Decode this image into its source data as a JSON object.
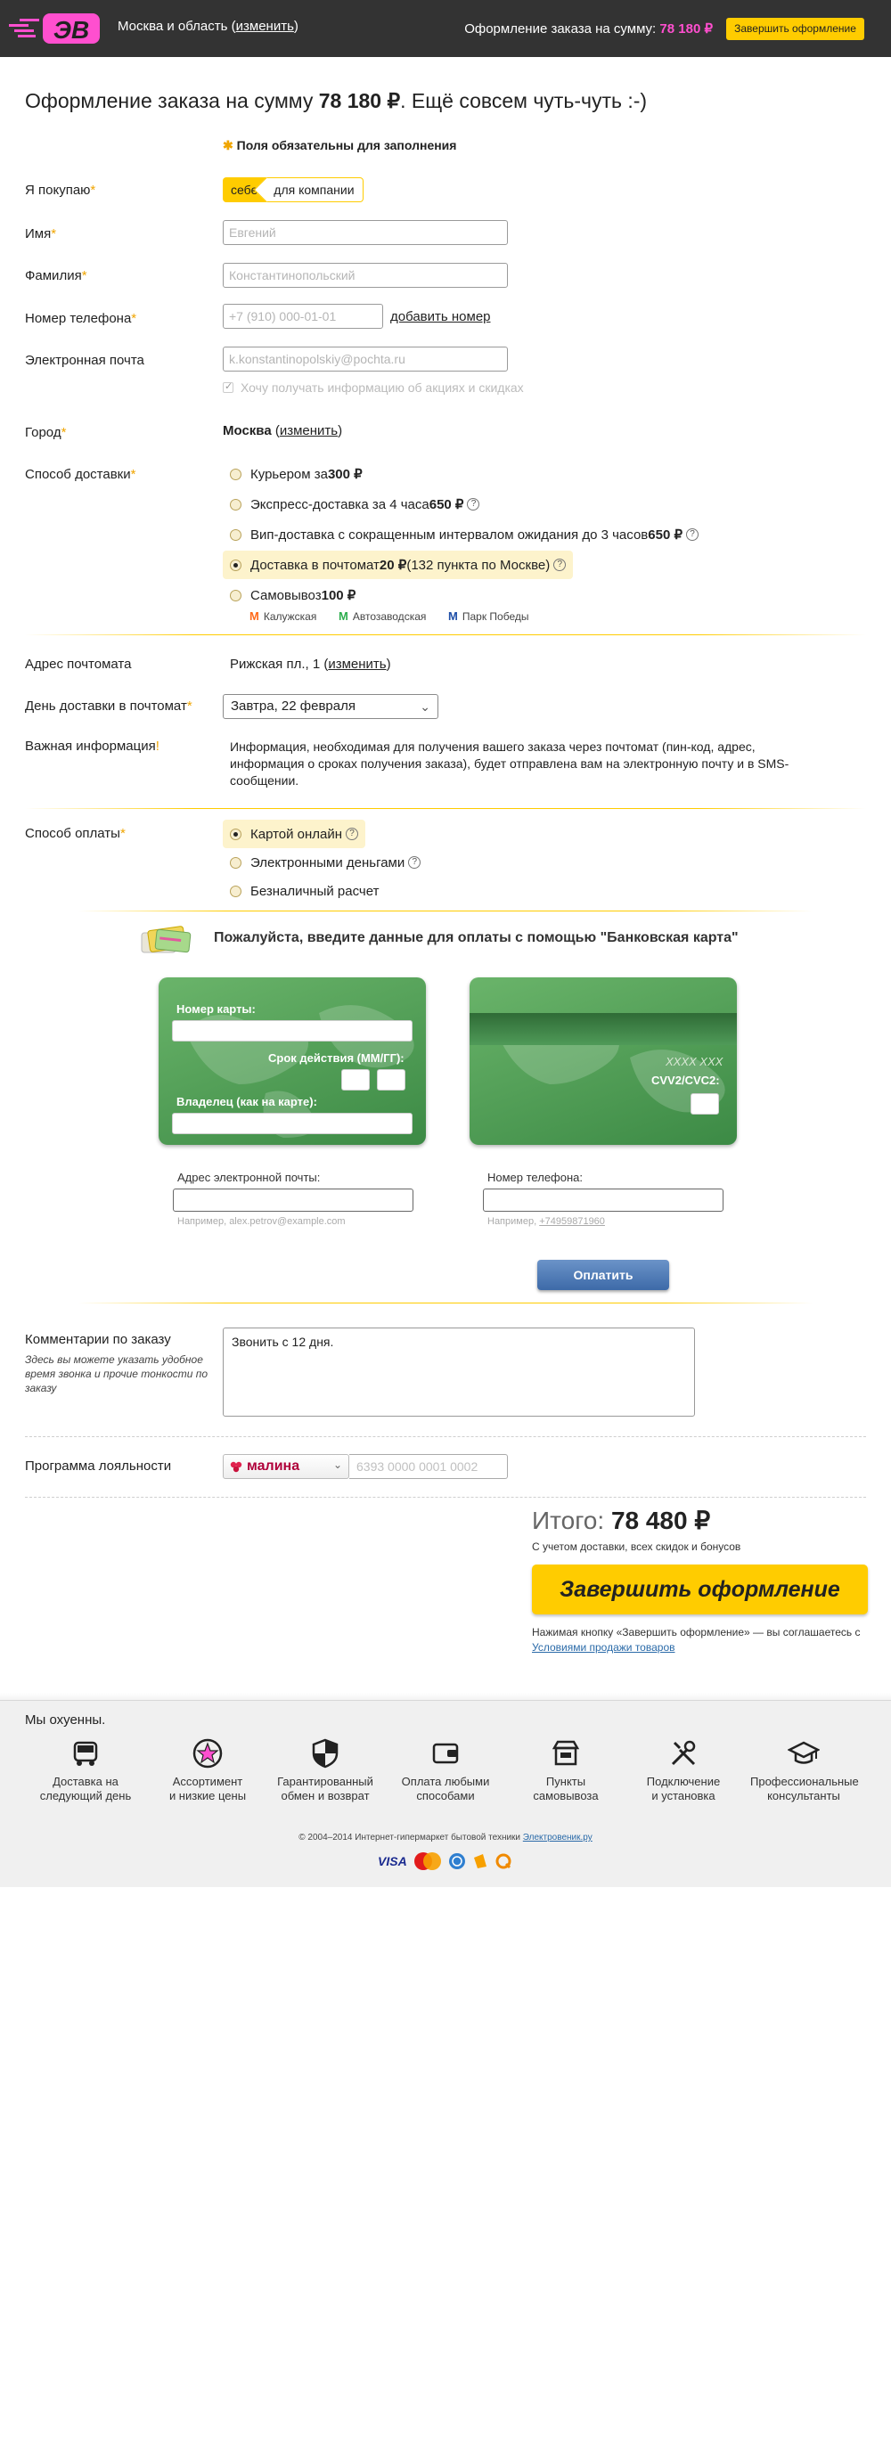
{
  "header": {
    "logo": "ЭВ",
    "region_text": "Москва и область (",
    "region_link": "изменить",
    "region_close": ")",
    "summary_label": "Оформление заказа на сумму:",
    "summary_amount": "78 180 ₽",
    "finish_button": "Завершить оформление"
  },
  "title": {
    "prefix": "Оформление заказа на сумму ",
    "amount": "78 180 ₽",
    "suffix": ". Ещё совсем чуть-чуть :-)"
  },
  "required_note": "Поля обязательны для заполнения",
  "buyer": {
    "label": "Я  покупаю",
    "option_self": "себе",
    "option_company": "для компании"
  },
  "fields": {
    "name_label": "Имя",
    "name_placeholder": "Евгений",
    "surname_label": "Фамилия",
    "surname_placeholder": "Константинопольский",
    "phone_label": "Номер телефона",
    "phone_placeholder": "+7 (910) 000-01-01",
    "add_phone_link": "добавить номер",
    "email_label": "Электронная почта",
    "email_placeholder": "k.konstantinopolskiy@pochta.ru",
    "subscribe_label": "Хочу получать информацию об акциях и скидках"
  },
  "city": {
    "label": "Город",
    "value": "Москва",
    "change_link": "изменить"
  },
  "delivery": {
    "label": "Способ доставки",
    "options": [
      {
        "pre": "Курьером за ",
        "bold": "300 ₽",
        "post": ""
      },
      {
        "pre": "Экспресс-доставка за 4 часа ",
        "bold": "650 ₽",
        "post": ""
      },
      {
        "pre": "Вип-доставка с сокращенным интервалом ожидания до 3 часов ",
        "bold": "650 ₽",
        "post": ""
      },
      {
        "pre": "Доставка в почтомат ",
        "bold": "20 ₽",
        "post": " (132 пункта по Москве)"
      },
      {
        "pre": "Самовывоз ",
        "bold": "100 ₽",
        "post": ""
      }
    ],
    "selected_index": 3,
    "metro": [
      {
        "name": "Калужская",
        "color": "#ff6a1a"
      },
      {
        "name": "Автозаводская",
        "color": "#2eae4e"
      },
      {
        "name": "Парк Победы",
        "color": "#1f4fa8"
      }
    ]
  },
  "postamat": {
    "address_label": "Адрес почтомата",
    "address_value": "Рижская пл., 1 (",
    "address_link": "изменить",
    "day_label": "День доставки в почтомат",
    "day_value": "Завтра, 22 февраля",
    "info_label": "Важная информация",
    "info_text": "Информация, необходимая для получения вашего заказа через почтомат (пин-код, адрес, информация о сроках получения заказа), будет отправлена вам на электронную почту и в SMS-сообщении."
  },
  "payment": {
    "label": "Способ оплаты",
    "options": [
      "Картой онлайн",
      "Электронными деньгами",
      "Безналичный расчет"
    ],
    "selected_index": 0,
    "card_title": "Пожалуйста, введите данные для оплаты с помощью \"Банковская карта\"",
    "card_number_label": "Номер карты:",
    "expiry_label": "Срок действия (ММ/ГГ):",
    "holder_label": "Владелец (как на карте):",
    "card_digits": "XXXX XXX",
    "cvv_label": "CVV2/CVC2:",
    "email_label": "Адрес электронной почты:",
    "email_hint": "Например, alex.petrov@example.com",
    "phone_label": "Номер телефона:",
    "phone_hint_pre": "Например, ",
    "phone_hint_num": "+74959871960",
    "pay_button": "Оплатить"
  },
  "comment": {
    "label": "Комментарии по заказу",
    "note": "Здесь вы можете указать удобное время звонка и прочие тонкости по заказу",
    "value": "Звонить с 12 дня."
  },
  "loyalty": {
    "label": "Программа лояльности",
    "brand": "малина",
    "placeholder": "6393 0000 0001 0002"
  },
  "total": {
    "label": "Итого: ",
    "amount": "78 480 ₽",
    "sub": "С учетом доставки, всех скидок и бонусов",
    "finish_button": "Завершить оформление",
    "agree_text": "Нажимая кнопку «Завершить оформление» — вы соглашаетесь с ",
    "agree_link": "Условиями продажи товаров"
  },
  "footer": {
    "title": "Мы охуенны.",
    "features": [
      {
        "line1": "Доставка на",
        "line2": "следующий день",
        "icon": "truck-icon"
      },
      {
        "line1": "Ассортимент",
        "line2": "и низкие цены",
        "icon": "star-icon"
      },
      {
        "line1": "Гарантированный",
        "line2": "обмен и возврат",
        "icon": "shield-icon"
      },
      {
        "line1": "Оплата любыми",
        "line2": "способами",
        "icon": "wallet-icon"
      },
      {
        "line1": "Пункты",
        "line2": "самовывоза",
        "icon": "shop-icon"
      },
      {
        "line1": "Подключение",
        "line2": "и установка",
        "icon": "tools-icon"
      },
      {
        "line1": "Профессиональные",
        "line2": "консультанты",
        "icon": "graduation-cap-icon"
      }
    ],
    "copyright": "© 2004–2014 Интернет-гипермаркет бытовой техники ",
    "copyright_link": "Электровеник.ру",
    "payment_logos": [
      "VISA",
      "MasterCard",
      "Webmoney",
      "Yandex.Money",
      "Qiwi"
    ]
  },
  "colors": {
    "accent": "#ffcc00",
    "brand_pink": "#ff4fcf",
    "header_bg": "#333333"
  }
}
